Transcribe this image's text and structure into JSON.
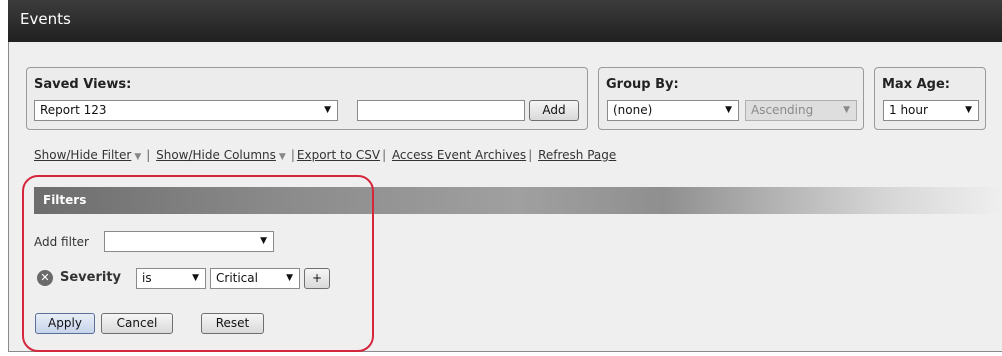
{
  "window": {
    "title": "Events"
  },
  "saved_views": {
    "label": "Saved Views:",
    "selected": "Report 123",
    "name_input_value": "",
    "add_button": "Add"
  },
  "group_by": {
    "label": "Group By:",
    "selected": "(none)",
    "order": "Ascending"
  },
  "max_age": {
    "label": "Max Age:",
    "selected": "1 hour"
  },
  "links": {
    "show_hide_filter": "Show/Hide Filter",
    "show_hide_columns": "Show/Hide Columns",
    "export_csv": "Export to CSV",
    "access_archives": "Access Event Archives",
    "refresh_page": "Refresh Page"
  },
  "filters": {
    "header": "Filters",
    "add_filter_label": "Add filter",
    "add_filter_value": "",
    "rule": {
      "field": "Severity",
      "operator": "is",
      "value": "Critical",
      "plus": "+"
    },
    "apply": "Apply",
    "cancel": "Cancel",
    "reset": "Reset"
  },
  "colors": {
    "highlight": "#d6263c",
    "titlebar": "#2a2a2a"
  }
}
